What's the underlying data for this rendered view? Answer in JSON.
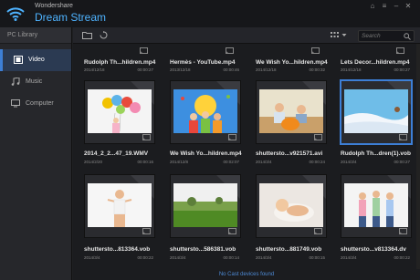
{
  "app": {
    "brand_small": "Wondershare",
    "brand_big": "Dream Stream"
  },
  "sidebar": {
    "header": "PC Library",
    "items": [
      {
        "label": "Video",
        "icon": "film-icon",
        "active": true
      },
      {
        "label": "Music",
        "icon": "music-note-icon",
        "active": false
      },
      {
        "label": "Computer",
        "icon": "monitor-icon",
        "active": false
      }
    ]
  },
  "search": {
    "placeholder": "Search"
  },
  "top_row": [
    {
      "name": "Rudolph Th...hildren.mp4",
      "date": "2014/12/18",
      "duration": "00:00:27"
    },
    {
      "name": "Hermès - YouTube.mp4",
      "date": "2013/12/18",
      "duration": "00:00:46"
    },
    {
      "name": "We Wish Yo...hildren.mp4",
      "date": "2014/12/18",
      "duration": "00:00:32"
    },
    {
      "name": "Lets Decor...hildren.mp4",
      "date": "2014/12/18",
      "duration": "00:00:27"
    }
  ],
  "middle_row": [
    {
      "name": "2014_2_2...47_19.WMV",
      "date": "2014/2/20",
      "duration": "00:00:16",
      "thumb": "balloons"
    },
    {
      "name": "We Wish Yo...hildren.mp4",
      "date": "2014/12/8",
      "duration": "00:02:07",
      "thumb": "kids"
    },
    {
      "name": "shuttersto...v921571.avi",
      "date": "2014/3/4",
      "duration": "00:00:24",
      "thumb": "pumpkin"
    },
    {
      "name": "Rudolph Th...dren(1).vob",
      "date": "2014/3/4",
      "duration": "00:00:27",
      "thumb": "snow",
      "selected": true
    }
  ],
  "bottom_row": [
    {
      "name": "shuttersto...813364.vob",
      "date": "2014/3/4",
      "duration": "00:00:22",
      "thumb": "woman"
    },
    {
      "name": "shuttersto...586381.vob",
      "date": "2014/3/4",
      "duration": "00:00:14",
      "thumb": "field"
    },
    {
      "name": "shuttersto...881749.vob",
      "date": "2014/3/4",
      "duration": "00:00:15",
      "thumb": "baby"
    },
    {
      "name": "shuttersto...v813364.dv",
      "date": "2014/3/4",
      "duration": "00:00:22",
      "thumb": "girls"
    }
  ],
  "status_text": "No Cast devices found",
  "colors": {
    "accent": "#3d7fd6",
    "brand": "#4eb3ff"
  }
}
